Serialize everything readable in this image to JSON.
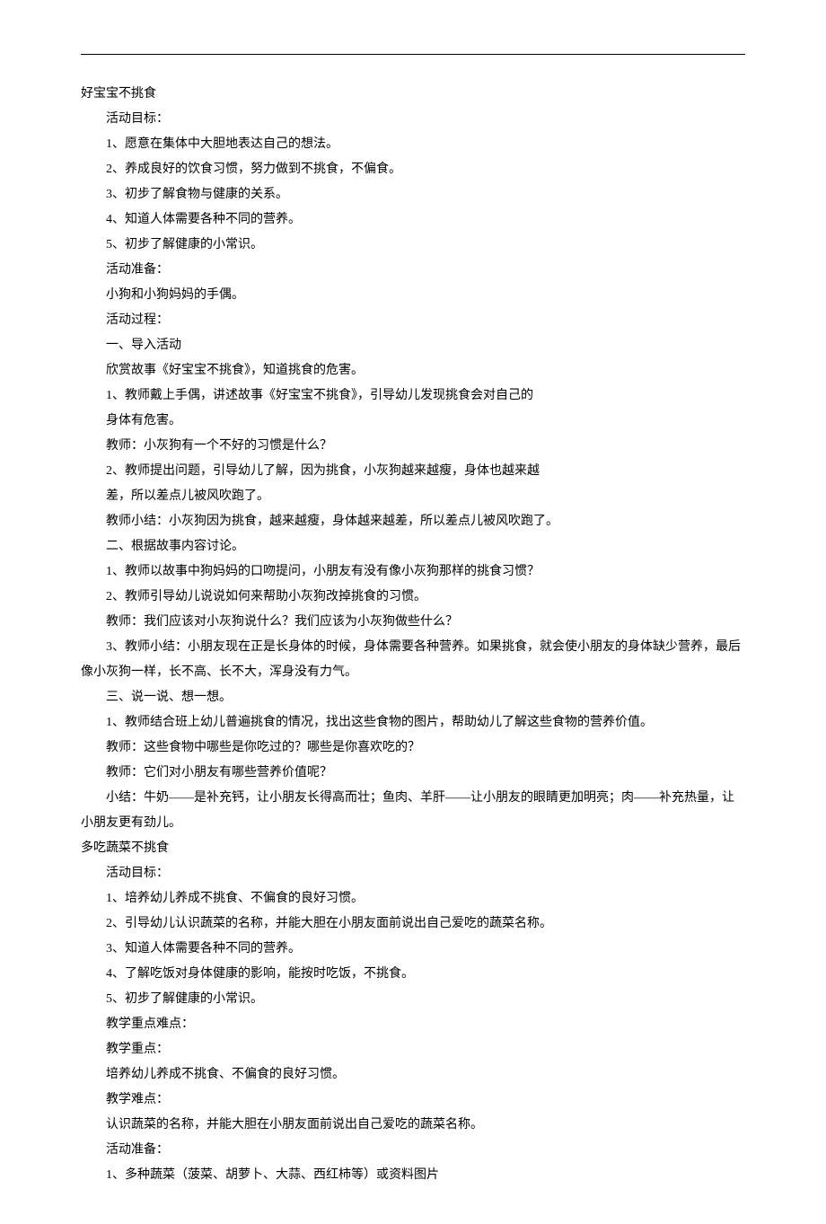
{
  "section1": {
    "title": "好宝宝不挑食",
    "goals_label": "活动目标：",
    "goals": [
      "1、愿意在集体中大胆地表达自己的想法。",
      "2、养成良好的饮食习惯，努力做到不挑食，不偏食。",
      "3、初步了解食物与健康的关系。",
      "4、知道人体需要各种不同的营养。",
      "5、初步了解健康的小常识。"
    ],
    "prep_label": "活动准备：",
    "prep": "小狗和小狗妈妈的手偶。",
    "process_label": "活动过程：",
    "part1_title": "一、导入活动",
    "part1_intro": "欣赏故事《好宝宝不挑食》，知道挑食的危害。",
    "part1_item1": "1、教师戴上手偶，讲述故事《好宝宝不挑食》，引导幼儿发现挑食会对自己的",
    "part1_item1b": "身体有危害。",
    "part1_q1": "教师：小灰狗有一个不好的习惯是什么？",
    "part1_item2": "2、教师提出问题，引导幼儿了解，因为挑食，小灰狗越来越瘦，身体也越来越",
    "part1_item2b": "差，所以差点儿被风吹跑了。",
    "part1_summary": "教师小结：小灰狗因为挑食，越来越瘦，身体越来越差，所以差点儿被风吹跑了。",
    "part2_title": "二、根据故事内容讨论。",
    "part2_item1": "1、教师以故事中狗妈妈的口吻提问，小朋友有没有像小灰狗那样的挑食习惯？",
    "part2_item2": "2、教师引导幼儿说说如何来帮助小灰狗改掉挑食的习惯。",
    "part2_q": "教师：我们应该对小灰狗说什么？我们应该为小灰狗做些什么？",
    "part2_summary": "3、教师小结：小朋友现在正是长身体的时候，身体需要各种营养。如果挑食，就会使小朋友的身体缺少营养，最后像小灰狗一样，长不高、长不大，浑身没有力气。",
    "part3_title": "三、说一说、想一想。",
    "part3_item1": "1、教师结合班上幼儿普遍挑食的情况，找出这些食物的图片，帮助幼儿了解这些食物的营养价值。",
    "part3_q1": "教师：这些食物中哪些是你吃过的？哪些是你喜欢吃的？",
    "part3_q2": "教师：它们对小朋友有哪些营养价值呢？",
    "part3_summary": "小结：牛奶——是补充钙，让小朋友长得高而壮；鱼肉、羊肝——让小朋友的眼睛更加明亮；肉——补充热量，让小朋友更有劲儿。"
  },
  "section2": {
    "title": "多吃蔬菜不挑食",
    "goals_label": "活动目标：",
    "goals": [
      "1、培养幼儿养成不挑食、不偏食的良好习惯。",
      "2、引导幼儿认识蔬菜的名称，并能大胆在小朋友面前说出自己爱吃的蔬菜名称。",
      "3、知道人体需要各种不同的营养。",
      "4、了解吃饭对身体健康的影响，能按时吃饭，不挑食。",
      "5、初步了解健康的小常识。"
    ],
    "points_label": "教学重点难点：",
    "key_label": "教学重点：",
    "key": "培养幼儿养成不挑食、不偏食的良好习惯。",
    "diff_label": "教学难点：",
    "diff": "认识蔬菜的名称，并能大胆在小朋友面前说出自己爱吃的蔬菜名称。",
    "prep_label": "活动准备：",
    "prep_item1": "1、多种蔬菜（菠菜、胡萝卜、大蒜、西红柿等）或资料图片"
  }
}
